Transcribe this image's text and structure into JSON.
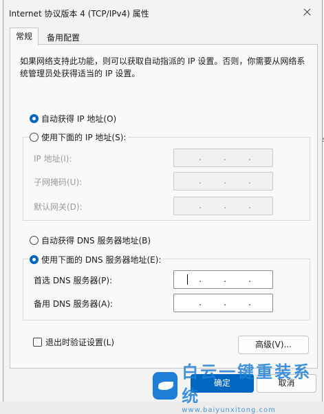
{
  "window": {
    "title": "Internet 协议版本 4 (TCP/IPv4) 属性"
  },
  "tabs": [
    {
      "label": "常规"
    },
    {
      "label": "备用配置"
    }
  ],
  "description": "如果网络支持此功能，则可以获取自动指派的 IP 设置。否则，你需要从网络系统管理员处获得适当的 IP 设置。",
  "ip": {
    "auto_label": "自动获得 IP 地址(O)",
    "manual_label": "使用下面的 IP 地址(S):",
    "auto_selected": true,
    "fields": [
      {
        "label": "IP 地址(I):",
        "value": " .   .   . "
      },
      {
        "label": "子网掩码(U):",
        "value": " .   .   . "
      },
      {
        "label": "默认网关(D):",
        "value": " .   .   . "
      }
    ]
  },
  "dns": {
    "auto_label": "自动获得 DNS 服务器地址(B)",
    "manual_label": "使用下面的 DNS 服务器地址(E):",
    "manual_selected": true,
    "fields": [
      {
        "label": "首选 DNS 服务器(P):"
      },
      {
        "label": "备用 DNS 服务器(A):"
      }
    ]
  },
  "validate_label": "退出时验证设置(L)",
  "advanced_label": "高级(V)...",
  "ok_label": "确定",
  "cancel_label": "取消",
  "watermark": {
    "brand": "白云一键重装系统",
    "url": "www.baiyunxitong.com",
    "color": "#1e7fd8"
  },
  "background": {
    "right_marks": [
      "、",
      "e"
    ]
  },
  "colors": {
    "accent": "#0067c0"
  }
}
